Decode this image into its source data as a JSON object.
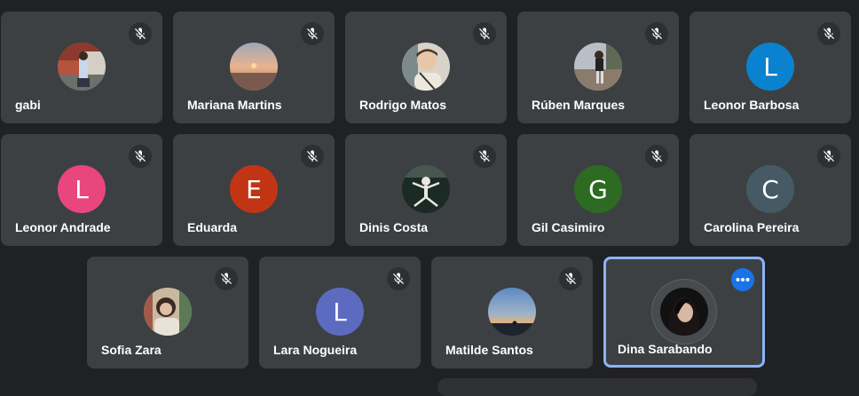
{
  "participants": [
    {
      "name": "gabi",
      "avatar": {
        "type": "photo",
        "kind": "street-photo"
      },
      "muted": true
    },
    {
      "name": "Mariana Martins",
      "avatar": {
        "type": "photo",
        "kind": "sunset-photo"
      },
      "muted": true
    },
    {
      "name": "Rodrigo Matos",
      "avatar": {
        "type": "photo",
        "kind": "portrait-photo"
      },
      "muted": true
    },
    {
      "name": "Rúben Marques",
      "avatar": {
        "type": "photo",
        "kind": "outdoor-photo"
      },
      "muted": true
    },
    {
      "name": "Leonor Barbosa",
      "avatar": {
        "type": "initial",
        "letter": "L",
        "color": "#0b82cf"
      },
      "muted": true
    },
    {
      "name": "Leonor Andrade",
      "avatar": {
        "type": "initial",
        "letter": "L",
        "color": "#e8467c"
      },
      "muted": true
    },
    {
      "name": "Eduarda",
      "avatar": {
        "type": "initial",
        "letter": "E",
        "color": "#c13515"
      },
      "muted": true
    },
    {
      "name": "Dinis Costa",
      "avatar": {
        "type": "photo",
        "kind": "skeleton-photo"
      },
      "muted": true
    },
    {
      "name": "Gil Casimiro",
      "avatar": {
        "type": "initial",
        "letter": "G",
        "color": "#2d6a22"
      },
      "muted": true
    },
    {
      "name": "Carolina Pereira",
      "avatar": {
        "type": "initial",
        "letter": "C",
        "color": "#455a64"
      },
      "muted": true
    },
    {
      "name": "Sofia Zara",
      "avatar": {
        "type": "photo",
        "kind": "selfie-photo"
      },
      "muted": true
    },
    {
      "name": "Lara Nogueira",
      "avatar": {
        "type": "initial",
        "letter": "L",
        "color": "#5c6bc0"
      },
      "muted": true
    },
    {
      "name": "Matilde Santos",
      "avatar": {
        "type": "photo",
        "kind": "dusk-photo"
      },
      "muted": true
    },
    {
      "name": "Dina Sarabando",
      "avatar": {
        "type": "photo",
        "kind": "dark-portrait-photo"
      },
      "muted": false,
      "active": true,
      "more_options": true
    }
  ],
  "icons": {
    "mute": "mic-off-icon",
    "more": "more-options-icon"
  },
  "colors": {
    "tile_bg": "#3c4043",
    "page_bg": "#202124",
    "active_border": "#8ab4f8",
    "more_button": "#1a73e8"
  }
}
